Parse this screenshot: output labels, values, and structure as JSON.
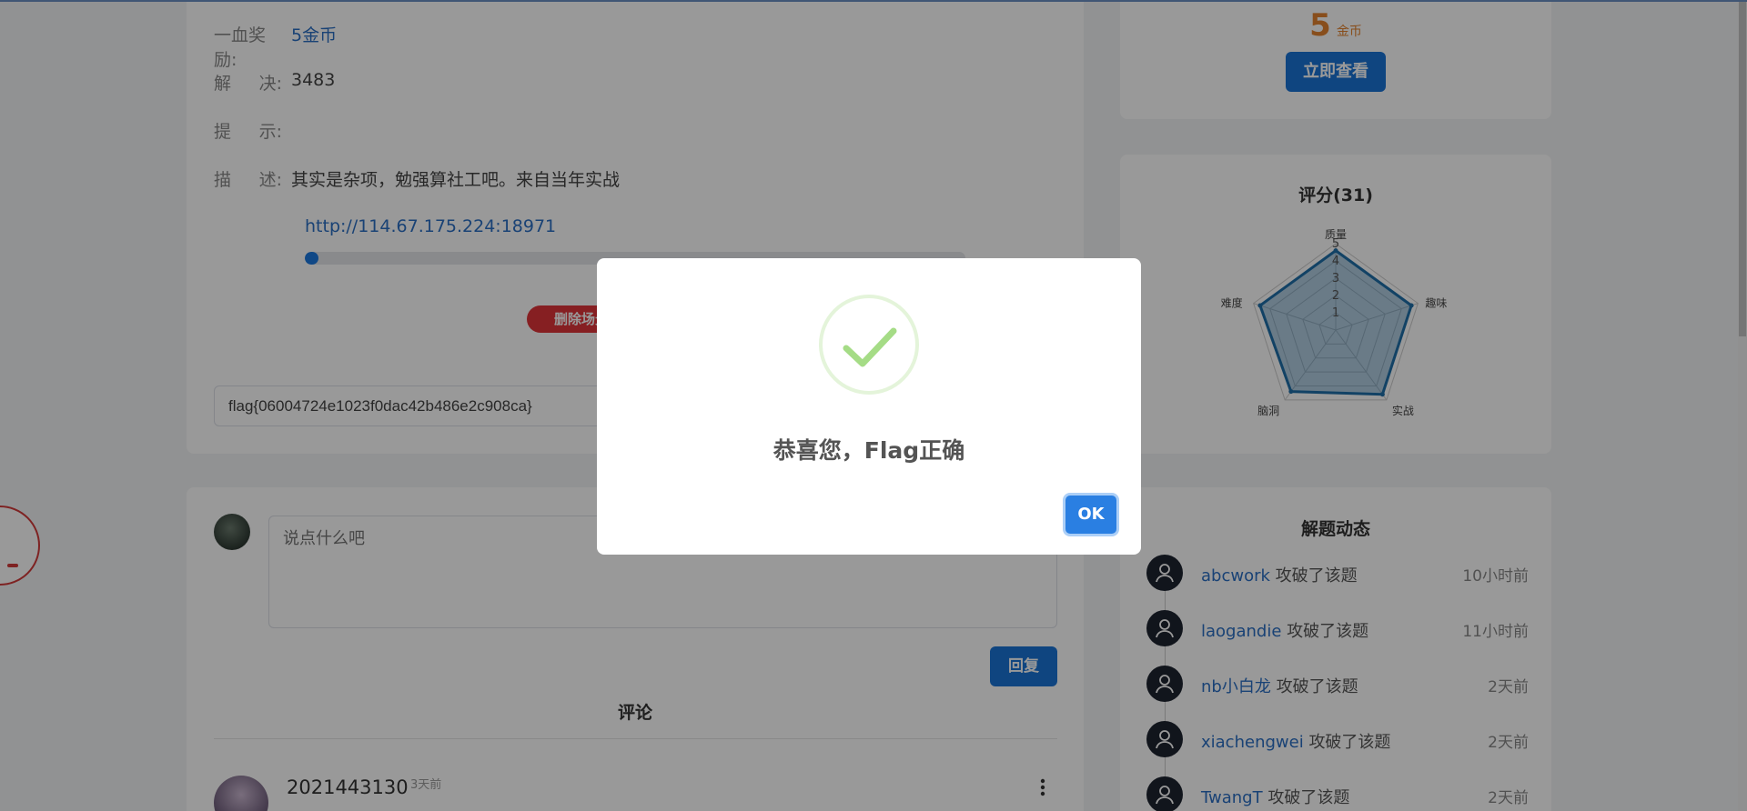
{
  "challenge": {
    "first_blood_label": "一血奖励:",
    "first_blood_value": "5金币",
    "solved_label_a": "解",
    "solved_label_b": "决:",
    "solved_value": "3483",
    "hint_label_a": "提",
    "hint_label_b": "示:",
    "hint_value": "",
    "desc_label_a": "描",
    "desc_label_b": "述:",
    "desc_value": "其实是杂项，勉强算社工吧。来自当年实战",
    "scene_url": "http://114.67.175.224:18971",
    "scene_progress_percent": 1,
    "delete_scene_label": "删除场景",
    "flag_value": "flag{06004724e1023f0dac42b486e2c908ca}"
  },
  "reward": {
    "coins": "5",
    "unit": "金币",
    "view_button": "立即查看"
  },
  "rating": {
    "title": "评分(31)"
  },
  "chart_data": {
    "type": "radar",
    "title": "评分(31)",
    "axes": [
      "质量",
      "趣味",
      "实战",
      "脑洞",
      "难度"
    ],
    "ticks": [
      "1",
      "2",
      "3",
      "4",
      "5"
    ],
    "range": [
      0,
      5
    ],
    "values": [
      4.6,
      4.6,
      4.6,
      4.4,
      4.6
    ],
    "color": "#1f6fa8"
  },
  "comments": {
    "placeholder": "说点什么吧",
    "reply_button": "回复",
    "section_title": "评论",
    "items": [
      {
        "user": "2021443130",
        "time": "3天前"
      }
    ]
  },
  "activity": {
    "title": "解题动态",
    "action": "攻破了该题",
    "items": [
      {
        "user": "abcwork",
        "time": "10小时前"
      },
      {
        "user": "laogandie",
        "time": "11小时前"
      },
      {
        "user": "nb小白龙",
        "time": "2天前"
      },
      {
        "user": "xiachengwei",
        "time": "2天前"
      },
      {
        "user": "TwangT",
        "time": "2天前"
      }
    ]
  },
  "dialog": {
    "message": "恭喜您，Flag正确",
    "ok_button": "OK",
    "icon": "success-check-icon"
  },
  "colors": {
    "accent": "#1a73d6",
    "danger": "#e0353a",
    "coin": "#e3832f",
    "success": "#a5dc86"
  }
}
